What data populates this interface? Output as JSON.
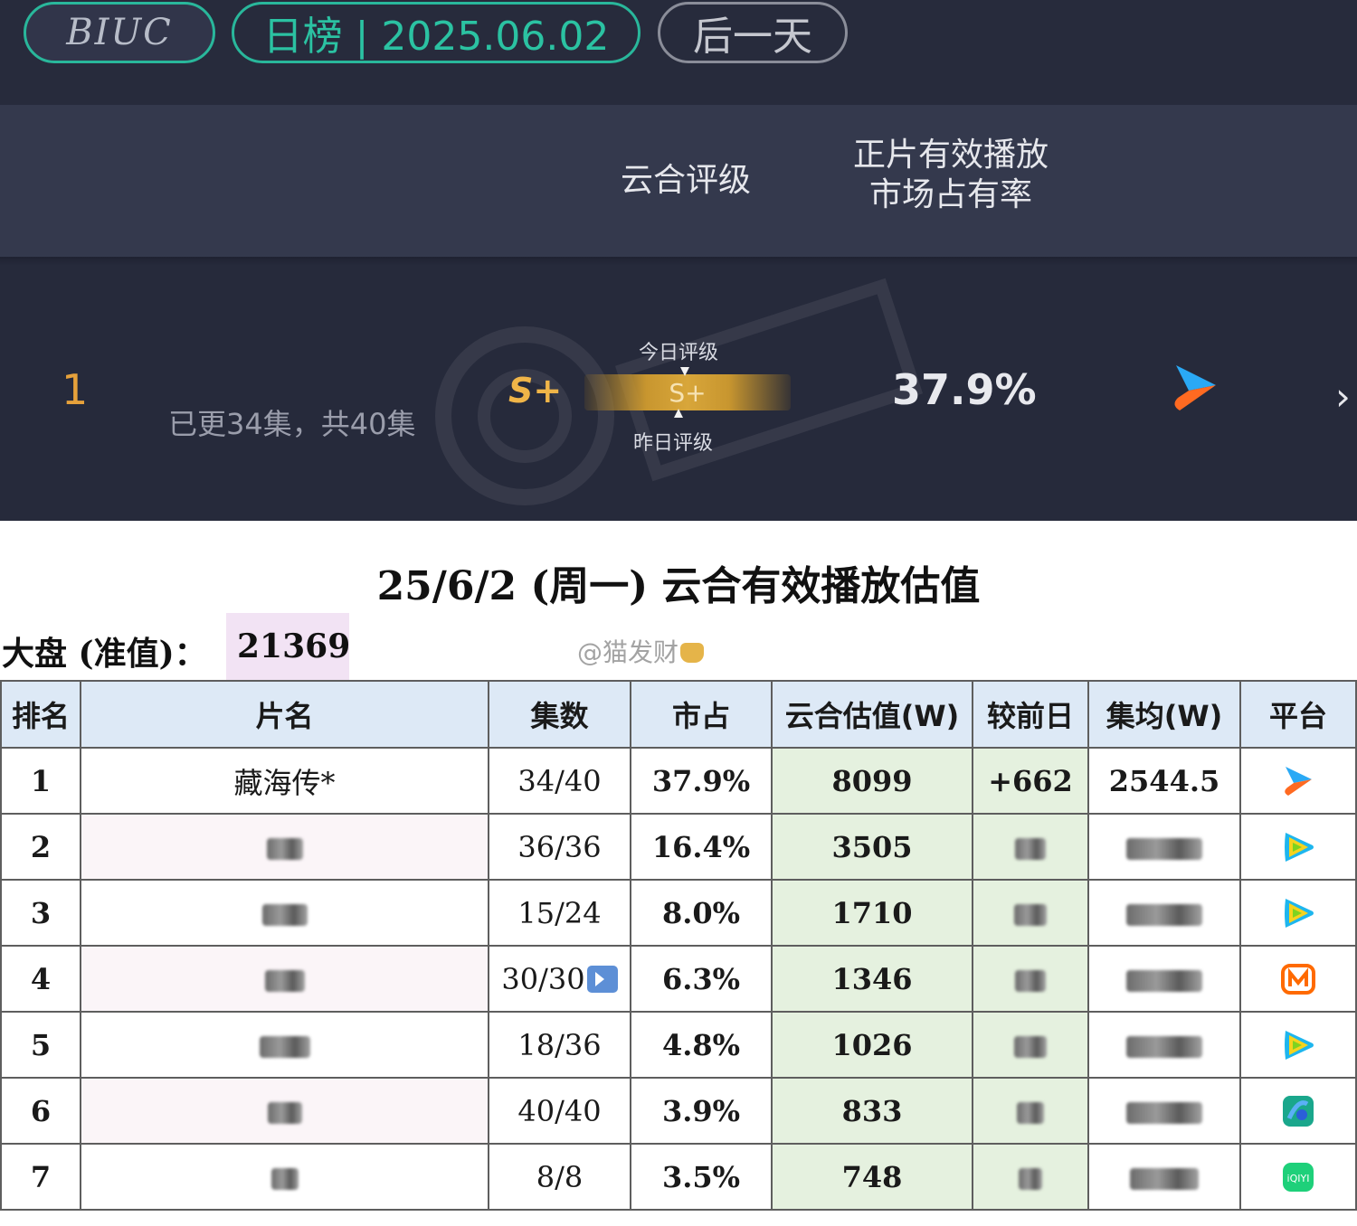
{
  "top": {
    "logo_text": "BIUC",
    "date_label": "日榜 | 2025.06.02",
    "next_day_button": "后一天",
    "col_rating": "云合评级",
    "col_share_line1": "正片有效播放",
    "col_share_line2": "市场占有率",
    "row": {
      "rank": "1",
      "episodes": "已更34集，共40集",
      "grade": "S+",
      "today_label": "今日评级",
      "today_grade": "S+",
      "yesterday_label": "昨日评级",
      "share": "37.9%",
      "platform_icon": "youku-icon"
    },
    "colors": {
      "bg": "#262a3b",
      "accent": "#2bc2a2",
      "gold": "#e6a13b"
    }
  },
  "sheet": {
    "title": "25/6/2 (周一) 云合有效播放估值",
    "dapan_label": "大盘  (准值)：",
    "dapan_value": "21369",
    "credit": "@猫发财",
    "headers": [
      "排名",
      "片名",
      "集数",
      "市占",
      "云合估值(W)",
      "较前日",
      "集均(W)",
      "平台"
    ],
    "rows": [
      {
        "rank": "1",
        "title": "藏海传*",
        "episodes": "34/40",
        "share": "37.9%",
        "value": "8099",
        "delta": "+662",
        "avg": "2544.5",
        "platform": "youku-icon",
        "ended": false
      },
      {
        "rank": "2",
        "title": "",
        "episodes": "36/36",
        "share": "16.4%",
        "value": "3505",
        "delta": "",
        "avg": "",
        "platform": "tencent-video-icon",
        "ended": false
      },
      {
        "rank": "3",
        "title": "",
        "episodes": "15/24",
        "share": "8.0%",
        "value": "1710",
        "delta": "",
        "avg": "",
        "platform": "tencent-video-icon",
        "ended": false
      },
      {
        "rank": "4",
        "title": "",
        "episodes": "30/30",
        "share": "6.3%",
        "value": "1346",
        "delta": "",
        "avg": "",
        "platform": "mango-tv-icon",
        "ended": true
      },
      {
        "rank": "5",
        "title": "",
        "episodes": "18/36",
        "share": "4.8%",
        "value": "1026",
        "delta": "",
        "avg": "",
        "platform": "tencent-video-icon",
        "ended": false
      },
      {
        "rank": "6",
        "title": "",
        "episodes": "40/40",
        "share": "3.9%",
        "value": "833",
        "delta": "",
        "avg": "",
        "platform": "tv-channel-icon",
        "ended": false
      },
      {
        "rank": "7",
        "title": "",
        "episodes": "8/8",
        "share": "3.5%",
        "value": "748",
        "delta": "",
        "avg": "",
        "platform": "iqiyi-icon",
        "ended": false
      }
    ]
  }
}
